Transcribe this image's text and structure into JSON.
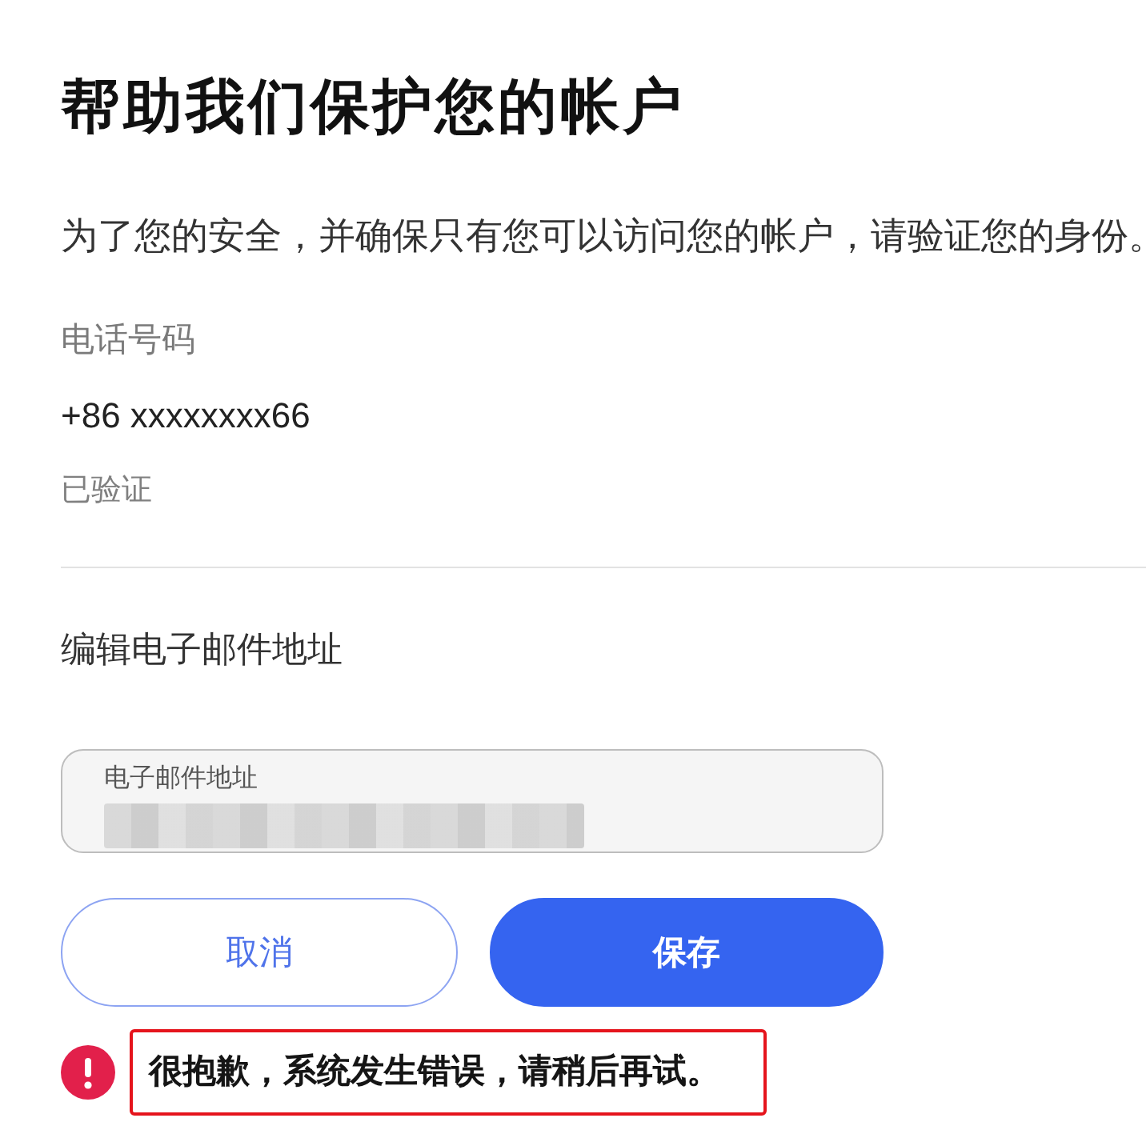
{
  "heading": "帮助我们保护您的帐户",
  "description": "为了您的安全，并确保只有您可以访问您的帐户，请验证您的身份。",
  "phone": {
    "label": "电话号码",
    "value": "+86 xxxxxxxx66",
    "status": "已验证"
  },
  "email_edit": {
    "title": "编辑电子邮件地址",
    "field": {
      "label": "电子邮件地址",
      "value_redacted": true
    }
  },
  "buttons": [
    {
      "label": "取消",
      "kind": "secondary"
    },
    {
      "label": "保存",
      "kind": "primary"
    }
  ],
  "error": {
    "message": "很抱歉，系统发生错误，请稍后再试。",
    "highlighted": true
  }
}
